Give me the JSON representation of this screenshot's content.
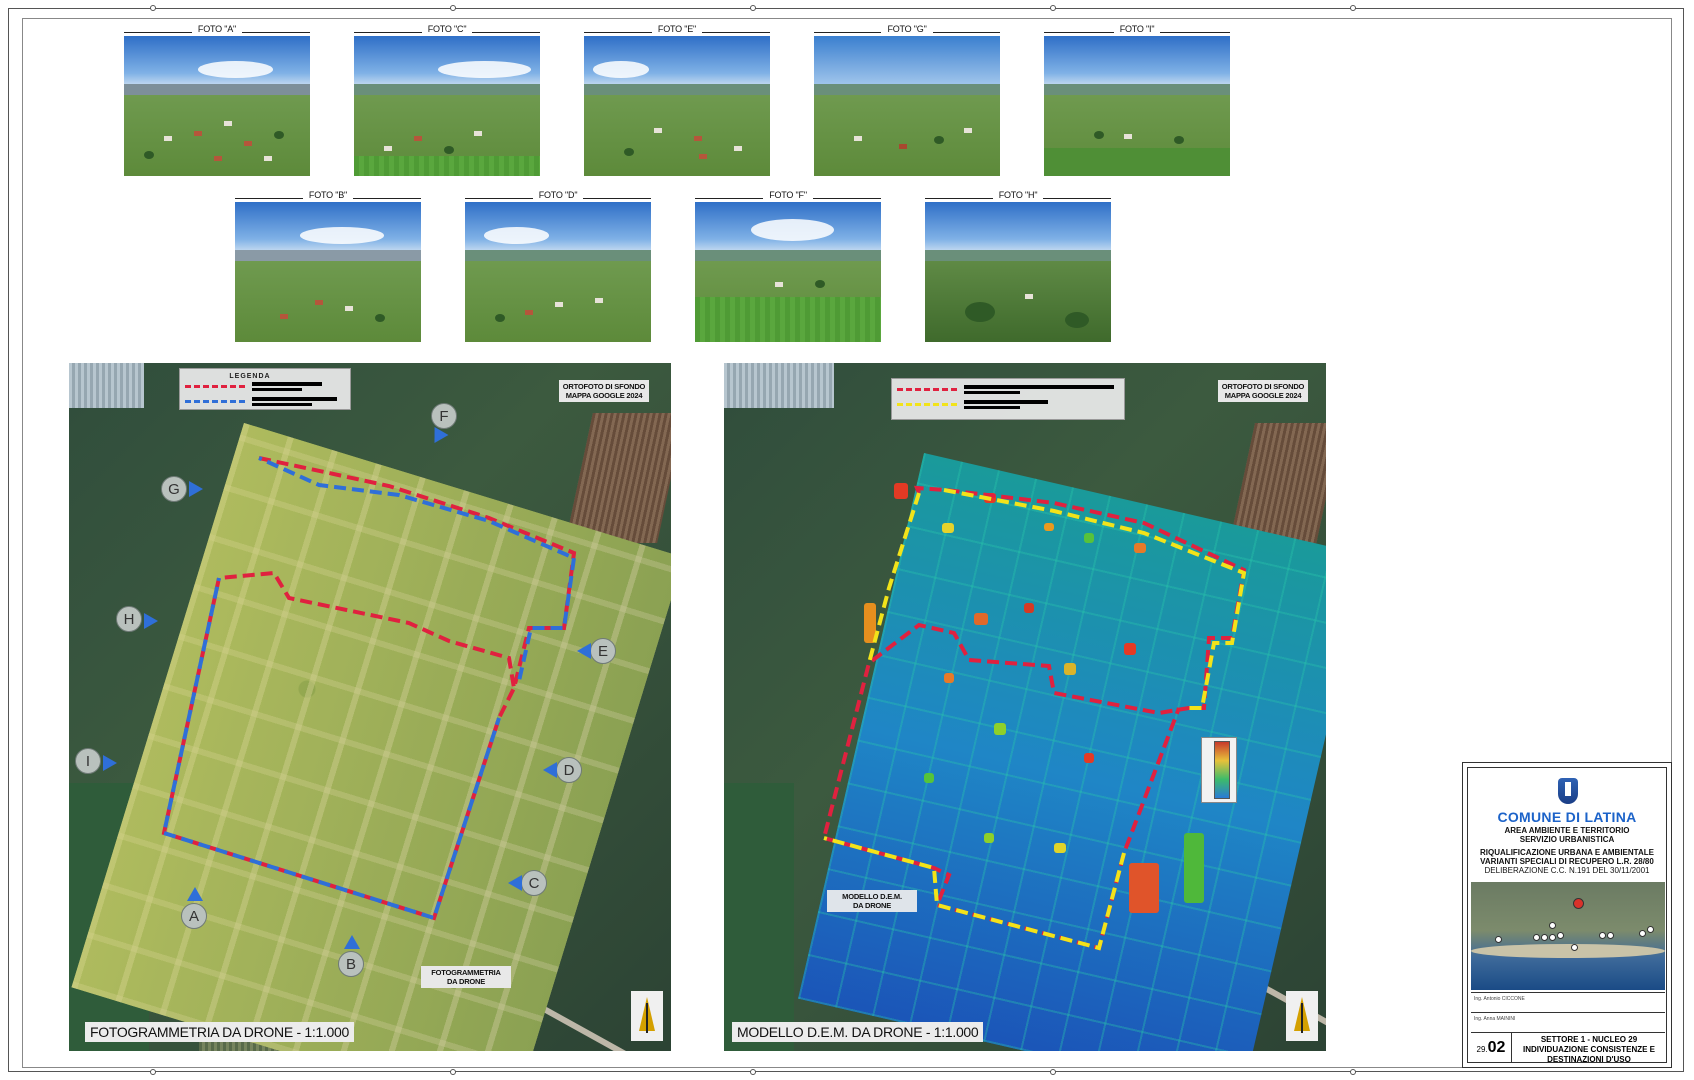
{
  "photos": {
    "top_row": [
      "FOTO \"A\"",
      "FOTO \"C\"",
      "FOTO \"E\"",
      "FOTO \"G\"",
      "FOTO \"I\""
    ],
    "bottom_row": [
      "FOTO \"B\"",
      "FOTO \"D\"",
      "FOTO \"F\"",
      "FOTO \"H\""
    ]
  },
  "left_map": {
    "legend_title": "LEGENDA",
    "ortho_label_1": "ORTOFOTO DI SFONDO",
    "ortho_label_2": "MAPPA GOOGLE 2024",
    "markers": [
      "A",
      "B",
      "C",
      "D",
      "E",
      "F",
      "G",
      "H",
      "I"
    ],
    "area_label_1": "FOTOGRAMMETRIA",
    "area_label_2": "DA DRONE",
    "title": "FOTOGRAMMETRIA DA DRONE - 1:1.000",
    "boundary_colors": {
      "red": "#e0213f",
      "blue": "#2f6fd8"
    }
  },
  "right_map": {
    "ortho_label_1": "ORTOFOTO DI SFONDO",
    "ortho_label_2": "MAPPA GOOGLE 2024",
    "area_label_1": "MODELLO D.E.M.",
    "area_label_2": "DA DRONE",
    "title": "MODELLO D.E.M. DA DRONE - 1:1.000",
    "boundary_colors": {
      "red": "#e0213f",
      "yellow": "#f2e31a"
    }
  },
  "title_block": {
    "comune": "COMUNE DI LATINA",
    "line1": "AREA AMBIENTE E TERRITORIO",
    "line2": "SERVIZIO URBANISTICA",
    "line3": "RIQUALIFICAZIONE URBANA E AMBIENTALE",
    "line4": "VARIANTI SPECIALI DI RECUPERO L.R. 28/80",
    "line5": "DELIBERAZIONE C.C. N.191 DEL 30/11/2001",
    "sig1": "Ing. Antonio CICCONE",
    "sig2": "Ing. Anna MAININI",
    "sheet_prefix": "29.",
    "sheet_number": "02",
    "sect1": "SETTORE 1 - NUCLEO 29",
    "sect2": "INDIVIDUAZIONE CONSISTENZE E",
    "sect3": "DESTINAZIONI D'USO"
  }
}
